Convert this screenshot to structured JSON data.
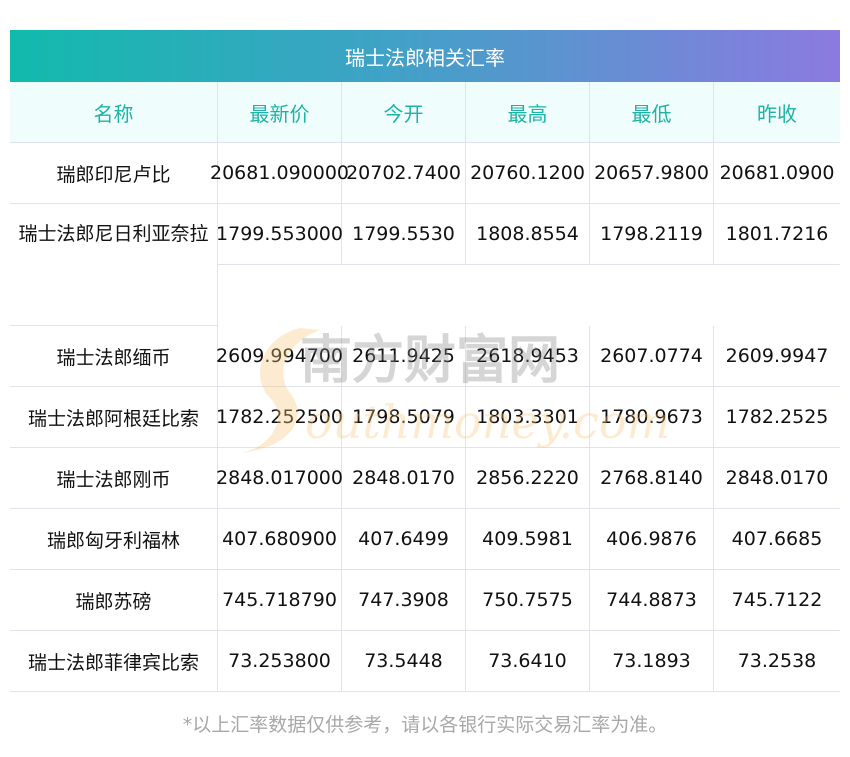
{
  "title": "瑞士法郎相关汇率",
  "columns": [
    "名称",
    "最新价",
    "今开",
    "最高",
    "最低",
    "昨收"
  ],
  "rows": [
    {
      "name": "瑞郎印尼卢比",
      "values": [
        "20681.090000",
        "20702.7400",
        "20760.1200",
        "20657.9800",
        "20681.0900"
      ]
    },
    {
      "name": "瑞士法郎尼日利亚奈拉",
      "values": [
        "1799.553000",
        "1799.5530",
        "1808.8554",
        "1798.2119",
        "1801.7216"
      ]
    },
    {
      "name": "瑞士法郎缅币",
      "values": [
        "2609.994700",
        "2611.9425",
        "2618.9453",
        "2607.0774",
        "2609.9947"
      ]
    },
    {
      "name": "瑞士法郎阿根廷比索",
      "values": [
        "1782.252500",
        "1798.5079",
        "1803.3301",
        "1780.9673",
        "1782.2525"
      ]
    },
    {
      "name": "瑞士法郎刚币",
      "values": [
        "2848.017000",
        "2848.0170",
        "2856.2220",
        "2768.8140",
        "2848.0170"
      ]
    },
    {
      "name": "瑞郎匈牙利福林",
      "values": [
        "407.680900",
        "407.6499",
        "409.5981",
        "406.9876",
        "407.6685"
      ]
    },
    {
      "name": "瑞郎苏磅",
      "values": [
        "745.718790",
        "747.3908",
        "750.7575",
        "744.8873",
        "745.7122"
      ]
    },
    {
      "name": "瑞士法郎菲律宾比索",
      "values": [
        "73.253800",
        "73.5448",
        "73.6410",
        "73.1893",
        "73.2538"
      ]
    }
  ],
  "note": "*以上汇率数据仅供参考，请以各银行实际交易汇率为准。",
  "watermark": {
    "cn": "南方财富网",
    "en": "southmoney.com"
  },
  "colors": {
    "accent": "#1fb3a6",
    "gradient_start": "#12baac",
    "gradient_end": "#8c7ae0"
  }
}
